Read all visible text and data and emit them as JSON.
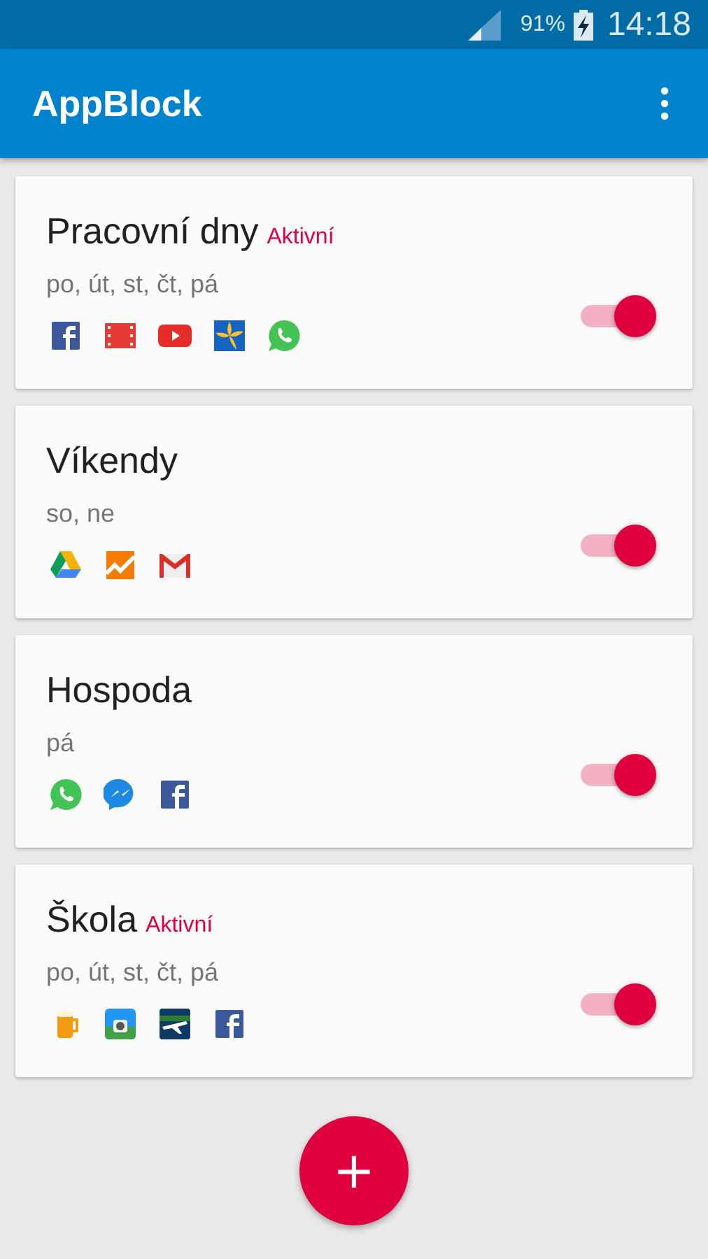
{
  "status_bar": {
    "battery": "91%",
    "time": "14:18"
  },
  "app_bar": {
    "title": "AppBlock"
  },
  "profiles": [
    {
      "name": "Pracovní dny",
      "badge": "Aktivní",
      "days": "po, út, st, čt, pá",
      "on": true,
      "apps": [
        {
          "kind": "f-square"
        },
        {
          "kind": "film"
        },
        {
          "kind": "play"
        },
        {
          "kind": "flower"
        },
        {
          "kind": "phone-bubble"
        }
      ]
    },
    {
      "name": "Víkendy",
      "days": "so, ne",
      "on": true,
      "apps": [
        {
          "kind": "triangle"
        },
        {
          "kind": "chart"
        },
        {
          "kind": "envelope"
        }
      ]
    },
    {
      "name": "Hospoda",
      "days": "pá",
      "on": true,
      "apps": [
        {
          "kind": "phone-bubble"
        },
        {
          "kind": "bolt-bubble"
        },
        {
          "kind": "f-square"
        }
      ]
    },
    {
      "name": "Škola",
      "badge": "Aktivní",
      "days": "po, út, st, čt, pá",
      "on": true,
      "apps": [
        {
          "kind": "mug"
        },
        {
          "kind": "camera"
        },
        {
          "kind": "plane"
        },
        {
          "kind": "f-square"
        }
      ]
    }
  ],
  "fab": {
    "label": "+"
  }
}
